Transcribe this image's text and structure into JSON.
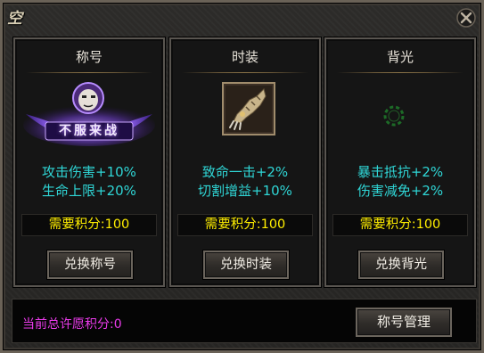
{
  "window": {
    "emblem_text": "空"
  },
  "panels": [
    {
      "title": "称号",
      "image_icon": "title-badge-icon",
      "image_text": "不服来战",
      "stats": [
        "攻击伤害+10%",
        "生命上限+20%"
      ],
      "cost": "需要积分:100",
      "button": "兑换称号"
    },
    {
      "title": "时装",
      "image_icon": "gauntlet-icon",
      "stats": [
        "致命一击+2%",
        "切割增益+10%"
      ],
      "cost": "需要积分:100",
      "button": "兑换时装"
    },
    {
      "title": "背光",
      "image_icon": "green-ring-icon",
      "stats": [
        "暴击抵抗+2%",
        "伤害减免+2%"
      ],
      "cost": "需要积分:100",
      "button": "兑换背光"
    }
  ],
  "footer": {
    "total_points": "当前总许愿积分:0",
    "manage_button": "称号管理"
  },
  "colors": {
    "stat": "#2fd6d6",
    "cost": "#ffee00",
    "total": "#ea3bea",
    "title": "#e9e4da"
  }
}
